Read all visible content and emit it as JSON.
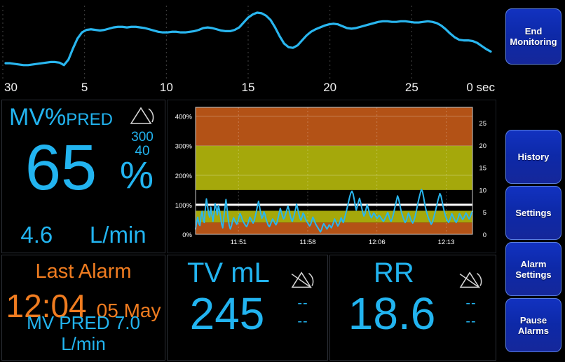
{
  "waveform": {
    "name": "respiration-waveform",
    "trace_color": "#29b6ef",
    "axis_unit_label": "0 sec",
    "x_ticks": [
      "30",
      "25",
      "20",
      "15",
      "10",
      "5",
      "0 sec"
    ],
    "x_tick_values": [
      30,
      25,
      20,
      15,
      10,
      5,
      0
    ],
    "samples": [
      0.18,
      0.18,
      0.17,
      0.16,
      0.15,
      0.15,
      0.16,
      0.17,
      0.18,
      0.19,
      0.2,
      0.2,
      0.19,
      0.15,
      0.24,
      0.42,
      0.58,
      0.68,
      0.72,
      0.73,
      0.72,
      0.71,
      0.72,
      0.74,
      0.76,
      0.77,
      0.77,
      0.76,
      0.77,
      0.77,
      0.76,
      0.75,
      0.73,
      0.71,
      0.69,
      0.68,
      0.68,
      0.69,
      0.69,
      0.68,
      0.68,
      0.69,
      0.7,
      0.72,
      0.75,
      0.76,
      0.75,
      0.73,
      0.71,
      0.7,
      0.7,
      0.72,
      0.76,
      0.84,
      0.92,
      0.97,
      1.0,
      0.99,
      0.95,
      0.88,
      0.76,
      0.62,
      0.5,
      0.44,
      0.43,
      0.47,
      0.55,
      0.63,
      0.69,
      0.73,
      0.76,
      0.79,
      0.81,
      0.82,
      0.81,
      0.78,
      0.75,
      0.74,
      0.75,
      0.77,
      0.79,
      0.81,
      0.83,
      0.85,
      0.86,
      0.86,
      0.85,
      0.85,
      0.86,
      0.86,
      0.85,
      0.84,
      0.84,
      0.85,
      0.86,
      0.85,
      0.83,
      0.79,
      0.73,
      0.66,
      0.6,
      0.56,
      0.55,
      0.55,
      0.54,
      0.51,
      0.46,
      0.41,
      0.37
    ]
  },
  "mv": {
    "title_main": "MV%",
    "title_sub": "PRED",
    "value": "65",
    "unit": "%",
    "secondary_value": "4.6",
    "secondary_unit": "L/min",
    "alarm_icon": "alarm-on-icon",
    "alarm_high": "300",
    "alarm_low": "40",
    "color": "#22b4f0"
  },
  "trend": {
    "name": "mv-percent-pred-trend",
    "left_axis_label": "%",
    "y_ticks_left": [
      "0%",
      "100%",
      "200%",
      "300%",
      "400%"
    ],
    "y_tick_values_left": [
      0,
      100,
      200,
      300,
      400
    ],
    "y_ticks_right": [
      "0",
      "5",
      "10",
      "15",
      "20",
      "25"
    ],
    "y_tick_values_right": [
      0,
      5,
      10,
      15,
      20,
      25
    ],
    "x_ticks": [
      "11:51",
      "11:58",
      "12:06",
      "12:13"
    ],
    "ylim": [
      0,
      430
    ],
    "bands": [
      {
        "name": "low-alarm-band",
        "from": 0,
        "to": 40,
        "color": "#b35216"
      },
      {
        "name": "low-caution-band",
        "from": 40,
        "to": 80,
        "color": "#a5a80b"
      },
      {
        "name": "normal-band",
        "from": 80,
        "to": 150,
        "color": "#000000"
      },
      {
        "name": "high-caution-band",
        "from": 150,
        "to": 300,
        "color": "#a5a80b"
      },
      {
        "name": "high-alarm-band",
        "from": 300,
        "to": 430,
        "color": "#b35216"
      }
    ],
    "reference_line": {
      "name": "pred-100-line",
      "value": 100,
      "color": "#ffffff"
    },
    "trace_color": "#29b6ef",
    "values": [
      18,
      42,
      58,
      36,
      30,
      60,
      78,
      52,
      40,
      86,
      120,
      96,
      70,
      58,
      92,
      66,
      44,
      70,
      104,
      88,
      66,
      98,
      82,
      60,
      34,
      22,
      58,
      88,
      118,
      86,
      52,
      30,
      18,
      28,
      44,
      56,
      48,
      40,
      34,
      44,
      60,
      70,
      62,
      50,
      42,
      36,
      30,
      26,
      34,
      46,
      58,
      52,
      44,
      38,
      46,
      62,
      78,
      96,
      112,
      92,
      70,
      54,
      62,
      76,
      66,
      50,
      40,
      30,
      26,
      34,
      44,
      52,
      46,
      38,
      32,
      40,
      56,
      72,
      88,
      76,
      62,
      52,
      58,
      70,
      82,
      96,
      84,
      66,
      52,
      44,
      54,
      68,
      84,
      102,
      88,
      70,
      56,
      48,
      58,
      72,
      66,
      54,
      46,
      40,
      34,
      28,
      34,
      46,
      58,
      50,
      40,
      32,
      26,
      20,
      14,
      8,
      16,
      28,
      36,
      30,
      24,
      18,
      24,
      32,
      28,
      22,
      30,
      40,
      52,
      44,
      36,
      28,
      34,
      44,
      56,
      48,
      40,
      52,
      66,
      80,
      96,
      112,
      128,
      140,
      146,
      138,
      120,
      98,
      82,
      96,
      110,
      122,
      108,
      90,
      74,
      62,
      70,
      86,
      100,
      88,
      74,
      62,
      56,
      64,
      72,
      68,
      60,
      54,
      58,
      64,
      60,
      54,
      48,
      44,
      50,
      58,
      66,
      74,
      62,
      50,
      44,
      52,
      66,
      82,
      98,
      114,
      130,
      120,
      102,
      84,
      70,
      58,
      48,
      40,
      46,
      58,
      72,
      64,
      52,
      44,
      38,
      46,
      58,
      74,
      92,
      110,
      126,
      140,
      152,
      144,
      126,
      104,
      86,
      72,
      60,
      50,
      42,
      34,
      40,
      52,
      66,
      80,
      96,
      112,
      126,
      138,
      130,
      112,
      94,
      78,
      64,
      54,
      46,
      40,
      48,
      58,
      70,
      62,
      54,
      46,
      40,
      48,
      58,
      70,
      64,
      56,
      50,
      56,
      64,
      72,
      66,
      58,
      52,
      60,
      70,
      78
    ]
  },
  "last_alarm": {
    "title": "Last Alarm",
    "time": "12:04",
    "date": "05 May",
    "detail": "MV PRED 7.0 L/min",
    "color": "#f07c20"
  },
  "tv": {
    "title": "TV mL",
    "value": "245",
    "alarm_icon": "alarm-off-icon",
    "alarm_high": "--",
    "alarm_low": "--",
    "color": "#22b4f0"
  },
  "rr": {
    "title": "RR",
    "value": "18.6",
    "alarm_icon": "alarm-off-icon",
    "alarm_high": "--",
    "alarm_low": "--",
    "color": "#22b4f0"
  },
  "sidebar": {
    "buttons": [
      {
        "id": "end-monitoring",
        "label": "End\nMonitoring"
      },
      {
        "id": "history",
        "label": "History"
      },
      {
        "id": "settings",
        "label": "Settings"
      },
      {
        "id": "alarm-settings",
        "label": "Alarm\nSettings"
      },
      {
        "id": "pause-alarms",
        "label": "Pause\nAlarms"
      }
    ],
    "button_color": "#1232c0",
    "button_border": "#5b7fdd"
  }
}
